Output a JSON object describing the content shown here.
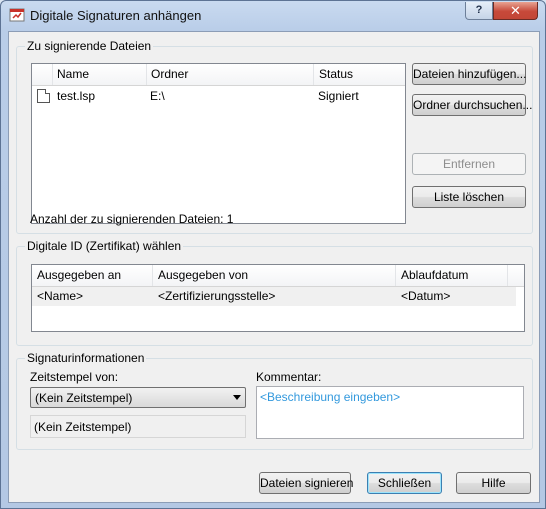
{
  "window": {
    "title": "Digitale Signaturen anhängen",
    "help_label": "?",
    "close_label": "✕"
  },
  "files_group": {
    "title": "Zu signierende Dateien",
    "columns": [
      "Name",
      "Ordner",
      "Status"
    ],
    "rows": [
      {
        "name": "test.lsp",
        "folder": "E:\\",
        "status": "Signiert"
      }
    ],
    "add_files_label": "Dateien hinzufügen...",
    "browse_folder_label": "Ordner durchsuchen...",
    "remove_label": "Entfernen",
    "clear_list_label": "Liste löschen",
    "count_text": "Anzahl der zu signierenden Dateien: 1"
  },
  "id_group": {
    "title": "Digitale ID (Zertifikat) wählen",
    "columns": [
      "Ausgegeben an",
      "Ausgegeben von",
      "Ablaufdatum"
    ],
    "rows": [
      {
        "issued_to": "<Name>",
        "issued_by": "<Zertifizierungsstelle>",
        "expires": "<Datum>"
      }
    ]
  },
  "signature_group": {
    "title": "Signaturinformationen",
    "timestamp_label": "Zeitstempel von:",
    "timestamp_value": "(Kein Zeitstempel)",
    "timestamp_readonly": "(Kein Zeitstempel)",
    "comment_label": "Kommentar:",
    "comment_placeholder": "<Beschreibung eingeben>"
  },
  "footer": {
    "sign_label": "Dateien signieren",
    "close_label": "Schließen",
    "help_label": "Hilfe"
  },
  "colors": {
    "accent_link": "#3399dd",
    "close_button": "#c7493a"
  }
}
